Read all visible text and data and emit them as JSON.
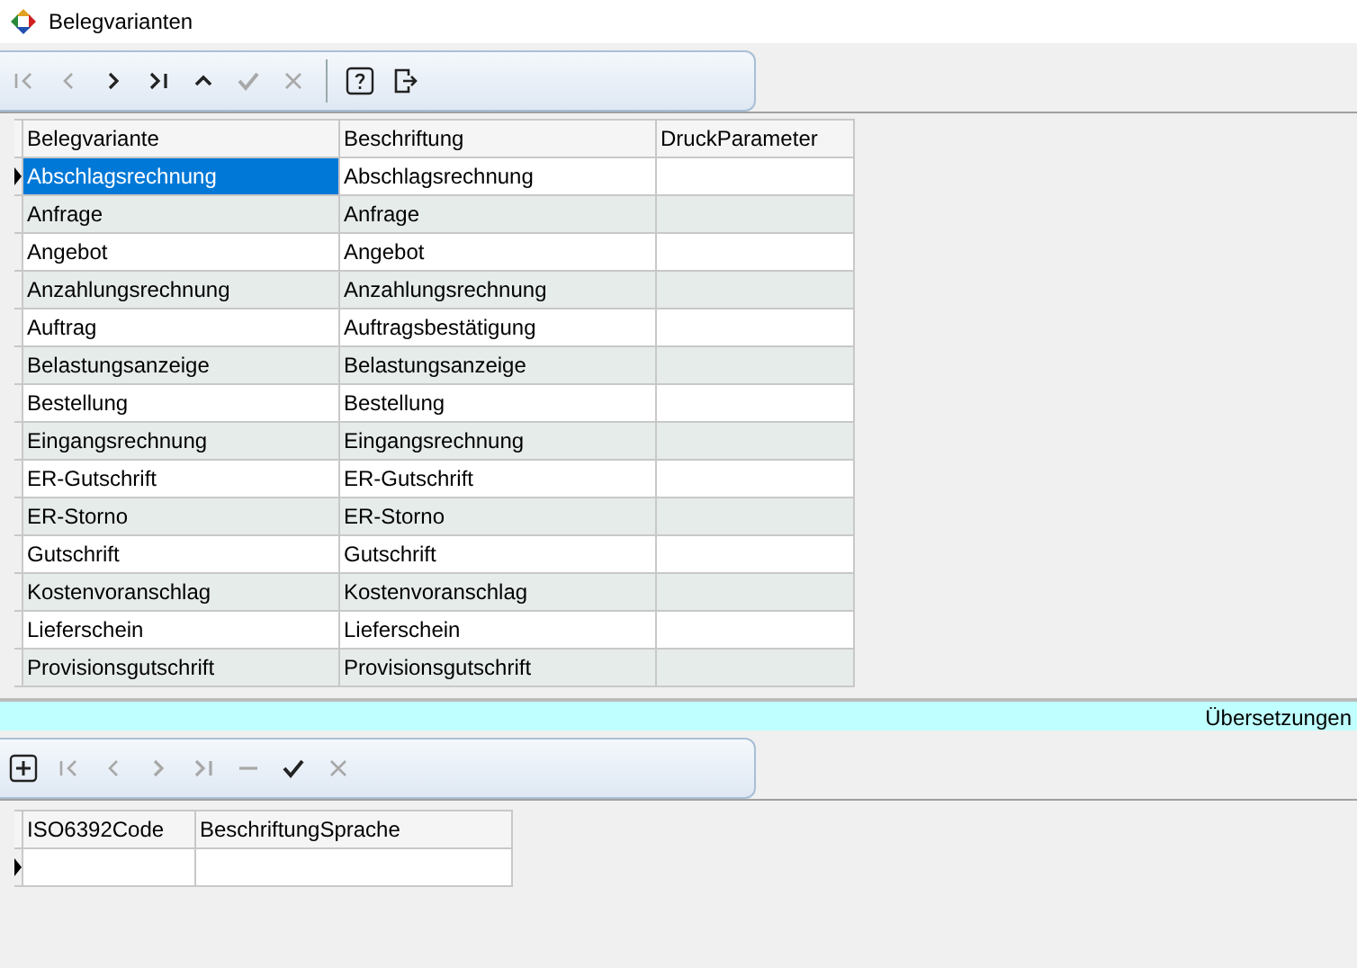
{
  "window": {
    "title": "Belegvarianten"
  },
  "toolbar": [
    {
      "kind": "first",
      "disabled": true
    },
    {
      "kind": "prev",
      "disabled": true
    },
    {
      "kind": "next",
      "disabled": false
    },
    {
      "kind": "last",
      "disabled": false
    },
    {
      "kind": "up",
      "disabled": false
    },
    {
      "kind": "check",
      "disabled": true
    },
    {
      "kind": "cancel",
      "disabled": true
    },
    {
      "kind": "separator"
    },
    {
      "kind": "help",
      "disabled": false
    },
    {
      "kind": "exit",
      "disabled": false
    }
  ],
  "table": {
    "columns": [
      "Belegvariante",
      "Beschriftung",
      "DruckParameter"
    ],
    "rows": [
      {
        "cells": [
          "Abschlagsrechnung",
          "Abschlagsrechnung",
          ""
        ],
        "selected": true
      },
      {
        "cells": [
          "Anfrage",
          "Anfrage",
          ""
        ],
        "selected": false
      },
      {
        "cells": [
          "Angebot",
          "Angebot",
          ""
        ],
        "selected": false
      },
      {
        "cells": [
          "Anzahlungsrechnung",
          "Anzahlungsrechnung",
          ""
        ],
        "selected": false
      },
      {
        "cells": [
          "Auftrag",
          "Auftragsbestätigung",
          ""
        ],
        "selected": false
      },
      {
        "cells": [
          "Belastungsanzeige",
          "Belastungsanzeige",
          ""
        ],
        "selected": false
      },
      {
        "cells": [
          "Bestellung",
          "Bestellung",
          ""
        ],
        "selected": false
      },
      {
        "cells": [
          "Eingangsrechnung",
          "Eingangsrechnung",
          ""
        ],
        "selected": false
      },
      {
        "cells": [
          "ER-Gutschrift",
          "ER-Gutschrift",
          ""
        ],
        "selected": false
      },
      {
        "cells": [
          "ER-Storno",
          "ER-Storno",
          ""
        ],
        "selected": false
      },
      {
        "cells": [
          "Gutschrift",
          "Gutschrift",
          ""
        ],
        "selected": false
      },
      {
        "cells": [
          "Kostenvoranschlag",
          "Kostenvoranschlag",
          ""
        ],
        "selected": false
      },
      {
        "cells": [
          "Lieferschein",
          "Lieferschein",
          ""
        ],
        "selected": false
      },
      {
        "cells": [
          "Provisionsgutschrift",
          "Provisionsgutschrift",
          ""
        ],
        "selected": false
      }
    ]
  },
  "section": {
    "title": "Übersetzungen"
  },
  "sub_toolbar": [
    {
      "kind": "add",
      "disabled": false
    },
    {
      "kind": "first",
      "disabled": true
    },
    {
      "kind": "prev",
      "disabled": true
    },
    {
      "kind": "next",
      "disabled": true
    },
    {
      "kind": "last",
      "disabled": true
    },
    {
      "kind": "minus",
      "disabled": true
    },
    {
      "kind": "check",
      "disabled": false
    },
    {
      "kind": "cancel",
      "disabled": true
    }
  ],
  "sub_table": {
    "columns": [
      "ISO6392Code",
      "BeschriftungSprache"
    ],
    "rows": [
      {
        "cells": [
          "",
          ""
        ],
        "selected": true
      }
    ]
  }
}
